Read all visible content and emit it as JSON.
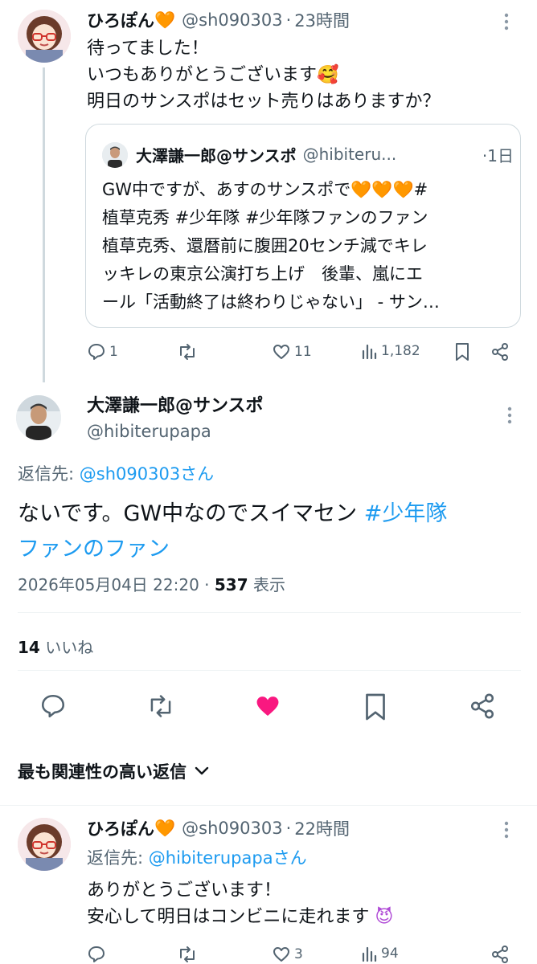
{
  "tweet1": {
    "name": "ひろぽん",
    "name_emoji": "🧡",
    "handle": "@sh090303",
    "time": "23時間",
    "text_line1": "待ってました！",
    "text_line2": "いつもありがとうございます",
    "text_line2_emoji": "🥰",
    "text_line3": "明日のサンスポはセット売りはありますか？",
    "quote": {
      "name": "大澤謙一郎@サンスポ",
      "handle": "@hibiteru...",
      "time": "·1日",
      "line1": "GW中ですが、あすのサンスポで",
      "line1_emoji": "🧡🧡🧡",
      "line1_tail": "#",
      "line2": "植草克秀 #少年隊 #少年隊ファンのファン",
      "line3": "植草克秀、還暦前に腹囲20センチ減でキレ",
      "line4": "ッキレの東京公演打ち上げ　後輩、嵐にエ",
      "line5": "ール「活動終了は終わりじゃない」 - サン…"
    },
    "stats": {
      "replies": "1",
      "likes": "11",
      "views": "1,182"
    }
  },
  "main_tweet": {
    "name": "大澤謙一郎@サンスポ",
    "handle": "@hibiterupapa",
    "reply_to_label": "返信先:",
    "reply_to_user": "@sh090303さん",
    "text_part1": "ないです。GW中なのでスイマセン",
    "hashtag_line1": "#少年隊",
    "hashtag_line2": "ファンのファン",
    "datetime": "2026年05月04日 22:20",
    "views_count": "537",
    "views_label": "表示",
    "likes_count": "14",
    "likes_label": "いいね",
    "colors": {
      "like_active": "#f91880",
      "link": "#1d9bf0"
    }
  },
  "replies_sort": {
    "label": "最も関連性の高い返信"
  },
  "tweet2": {
    "name": "ひろぽん",
    "name_emoji": "🧡",
    "handle": "@sh090303",
    "time": "22時間",
    "reply_to_label": "返信先:",
    "reply_to_user": "@hibiterupapaさん",
    "text_line1": "ありがとうございます！",
    "text_line2": "安心して明日はコンビニに走れます",
    "text_line2_emoji": "😈",
    "stats": {
      "replies": "",
      "likes": "3",
      "views": "94"
    }
  }
}
